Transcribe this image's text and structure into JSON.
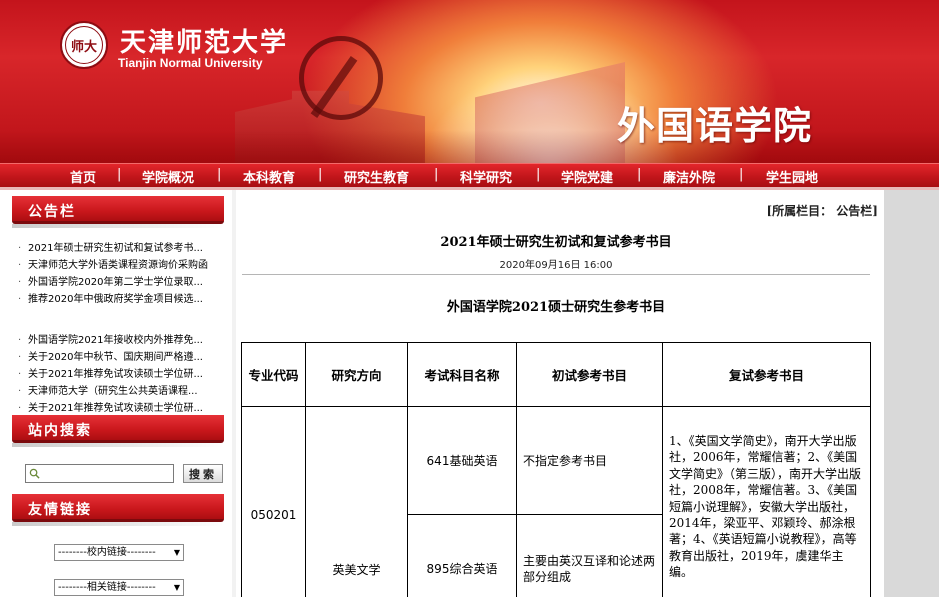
{
  "header": {
    "seal_text": "师大",
    "university_cn": "天津师范大学",
    "university_en": "Tianjin Normal University",
    "college": "外国语学院"
  },
  "nav": {
    "items": [
      "首页",
      "学院概况",
      "本科教育",
      "研究生教育",
      "科学研究",
      "学院党建",
      "廉洁外院",
      "学生园地"
    ],
    "separator": "|"
  },
  "sidebar": {
    "notice_title": "公告栏",
    "notices_group1": [
      "2021年硕士研究生初试和复试参考书...",
      "天津师范大学外语类课程资源询价采购函",
      "外国语学院2020年第二学士学位录取...",
      "推荐2020年中俄政府奖学金项目候选..."
    ],
    "notices_group2": [
      "外国语学院2021年接收校内外推荐免...",
      "关于2020年中秋节、国庆期间严格遵...",
      "关于2021年推荐免试攻读硕士学位研...",
      "天津师范大学（研究生公共英语课程...",
      "关于2021年推荐免试攻读硕士学位研..."
    ],
    "search_title": "站内搜索",
    "search_placeholder": "",
    "search_button": "搜索",
    "links_title": "友情链接",
    "link_select_1": "--------校内链接--------",
    "link_select_2": "--------相关链接--------",
    "bullet": "·"
  },
  "main": {
    "category": "[所属栏目： 公告栏]",
    "title": "2021年硕士研究生初试和复试参考书目",
    "date": "2020年09月16日  16:00",
    "doc_title": "外国语学院2021硕士研究生参考书目",
    "table": {
      "headers": [
        "专业代码",
        "研究方向",
        "考试科目名称",
        "初试参考书目",
        "复试参考书目"
      ],
      "code": "050201",
      "direction": "英美文学",
      "rows": [
        {
          "subject": "641基础英语",
          "initial": "不指定参考书目"
        },
        {
          "subject": "895综合英语",
          "initial": "主要由英汉互译和论述两部分组成"
        }
      ],
      "retest": "1、《英国文学简史》，南开大学出版社，2006年，常耀信著；2、《美国文学简史》（第三版），南开大学出版社，2008年，常耀信著。3、《美国短篇小说理解》，安徽大学出版社，2014年，梁亚平、邓颖玲、郝涂根著；4、《英语短篇小说教程》，高等教育出版社，2019年，虞建华主编。"
    }
  }
}
